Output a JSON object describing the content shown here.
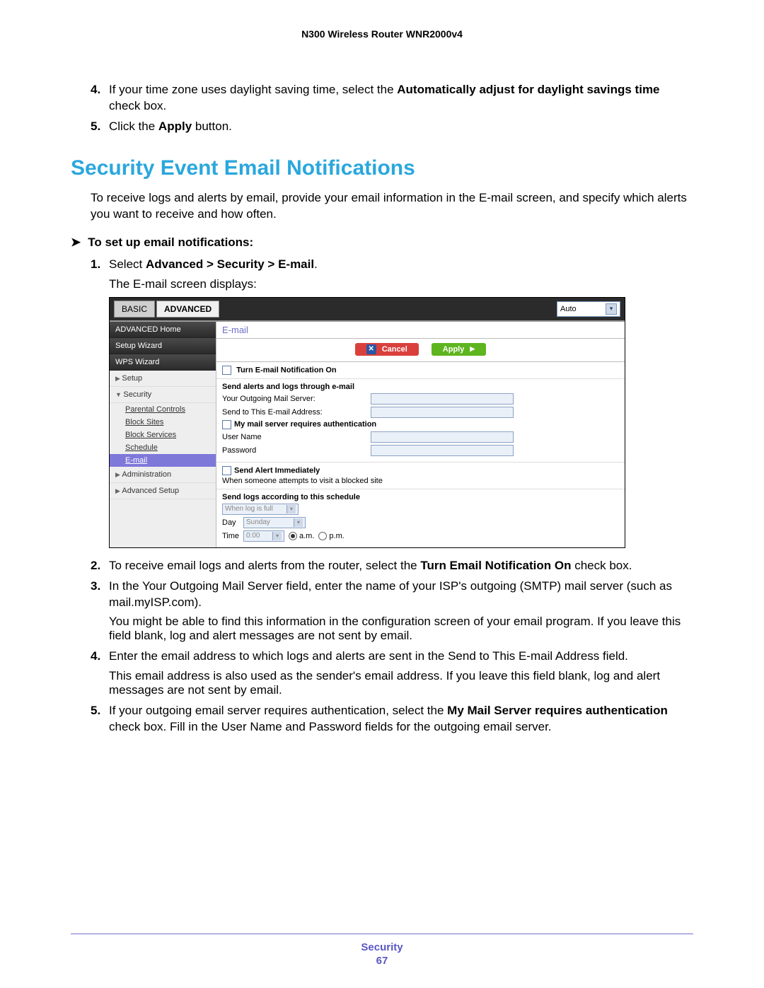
{
  "doc": {
    "header": "N300 Wireless Router WNR2000v4",
    "section_heading": "Security Event Email Notifications",
    "footer_section": "Security",
    "footer_page": "67"
  },
  "top_steps": {
    "s4_num": "4.",
    "s4_a": "If your time zone uses daylight saving time, select the ",
    "s4_bold": "Automatically adjust for daylight savings time",
    "s4_b": " check box.",
    "s5_num": "5.",
    "s5_a": "Click the ",
    "s5_bold": "Apply",
    "s5_b": " button."
  },
  "intro": "To receive logs and alerts by email, provide your email information in the E-mail screen, and specify which alerts you want to receive and how often.",
  "task": {
    "arrow": "➤",
    "title": "To set up email notifications:",
    "s1_num": "1.",
    "s1_a": "Select ",
    "s1_bold": "Advanced > Security > E-mail",
    "s1_b": ".",
    "s1_sub": "The E-mail screen displays:"
  },
  "ui": {
    "tabs": {
      "basic": "BASIC",
      "advanced": "ADVANCED"
    },
    "auto": "Auto",
    "side": {
      "adv_home": "ADVANCED Home",
      "setup_wizard": "Setup Wizard",
      "wps_wizard": "WPS Wizard",
      "setup": "Setup",
      "security": "Security",
      "parental": "Parental Controls",
      "block_sites": "Block Sites",
      "block_services": "Block Services",
      "schedule": "Schedule",
      "email": "E-mail",
      "administration": "Administration",
      "adv_setup": "Advanced Setup"
    },
    "main": {
      "title": "E-mail",
      "cancel": "Cancel",
      "apply": "Apply",
      "turn_on": "Turn E-mail Notification On",
      "send_alerts_head": "Send alerts and logs through e-mail",
      "outgoing_lbl": "Your Outgoing Mail Server:",
      "sendto_lbl": "Send to This E-mail Address:",
      "auth_chk": "My mail server requires authentication",
      "user_lbl": "User Name",
      "pass_lbl": "Password",
      "alert_head": "Send Alert Immediately",
      "alert_desc": "When someone attempts to visit a blocked site",
      "sched_head": "Send logs according to this schedule",
      "sched_val": "When log is full",
      "day_lbl": "Day",
      "day_val": "Sunday",
      "time_lbl": "Time",
      "time_val": "0:00",
      "am": "a.m.",
      "pm": "p.m."
    }
  },
  "steps_after": {
    "s2_num": "2.",
    "s2_a": "To receive email logs and alerts from the router, select the ",
    "s2_bold": "Turn Email Notification On",
    "s2_b": " check box.",
    "s3_num": "3.",
    "s3": "In the Your Outgoing Mail Server field, enter the name of your ISP's outgoing (SMTP) mail server (such as mail.myISP.com).",
    "s3_sub": "You might be able to find this information in the configuration screen of your email program. If you leave this field blank, log and alert messages are not sent by email.",
    "s4_num": "4.",
    "s4": "Enter the email address to which logs and alerts are sent in the Send to This E-mail Address field.",
    "s4_sub": "This email address is also used as the sender's email address. If you leave this field blank, log and alert messages are not sent by email.",
    "s5_num": "5.",
    "s5_a": "If your outgoing email server requires authentication, select the ",
    "s5_bold": "My Mail Server requires authentication",
    "s5_b": " check box. Fill in the User Name and Password fields for the outgoing email server."
  }
}
